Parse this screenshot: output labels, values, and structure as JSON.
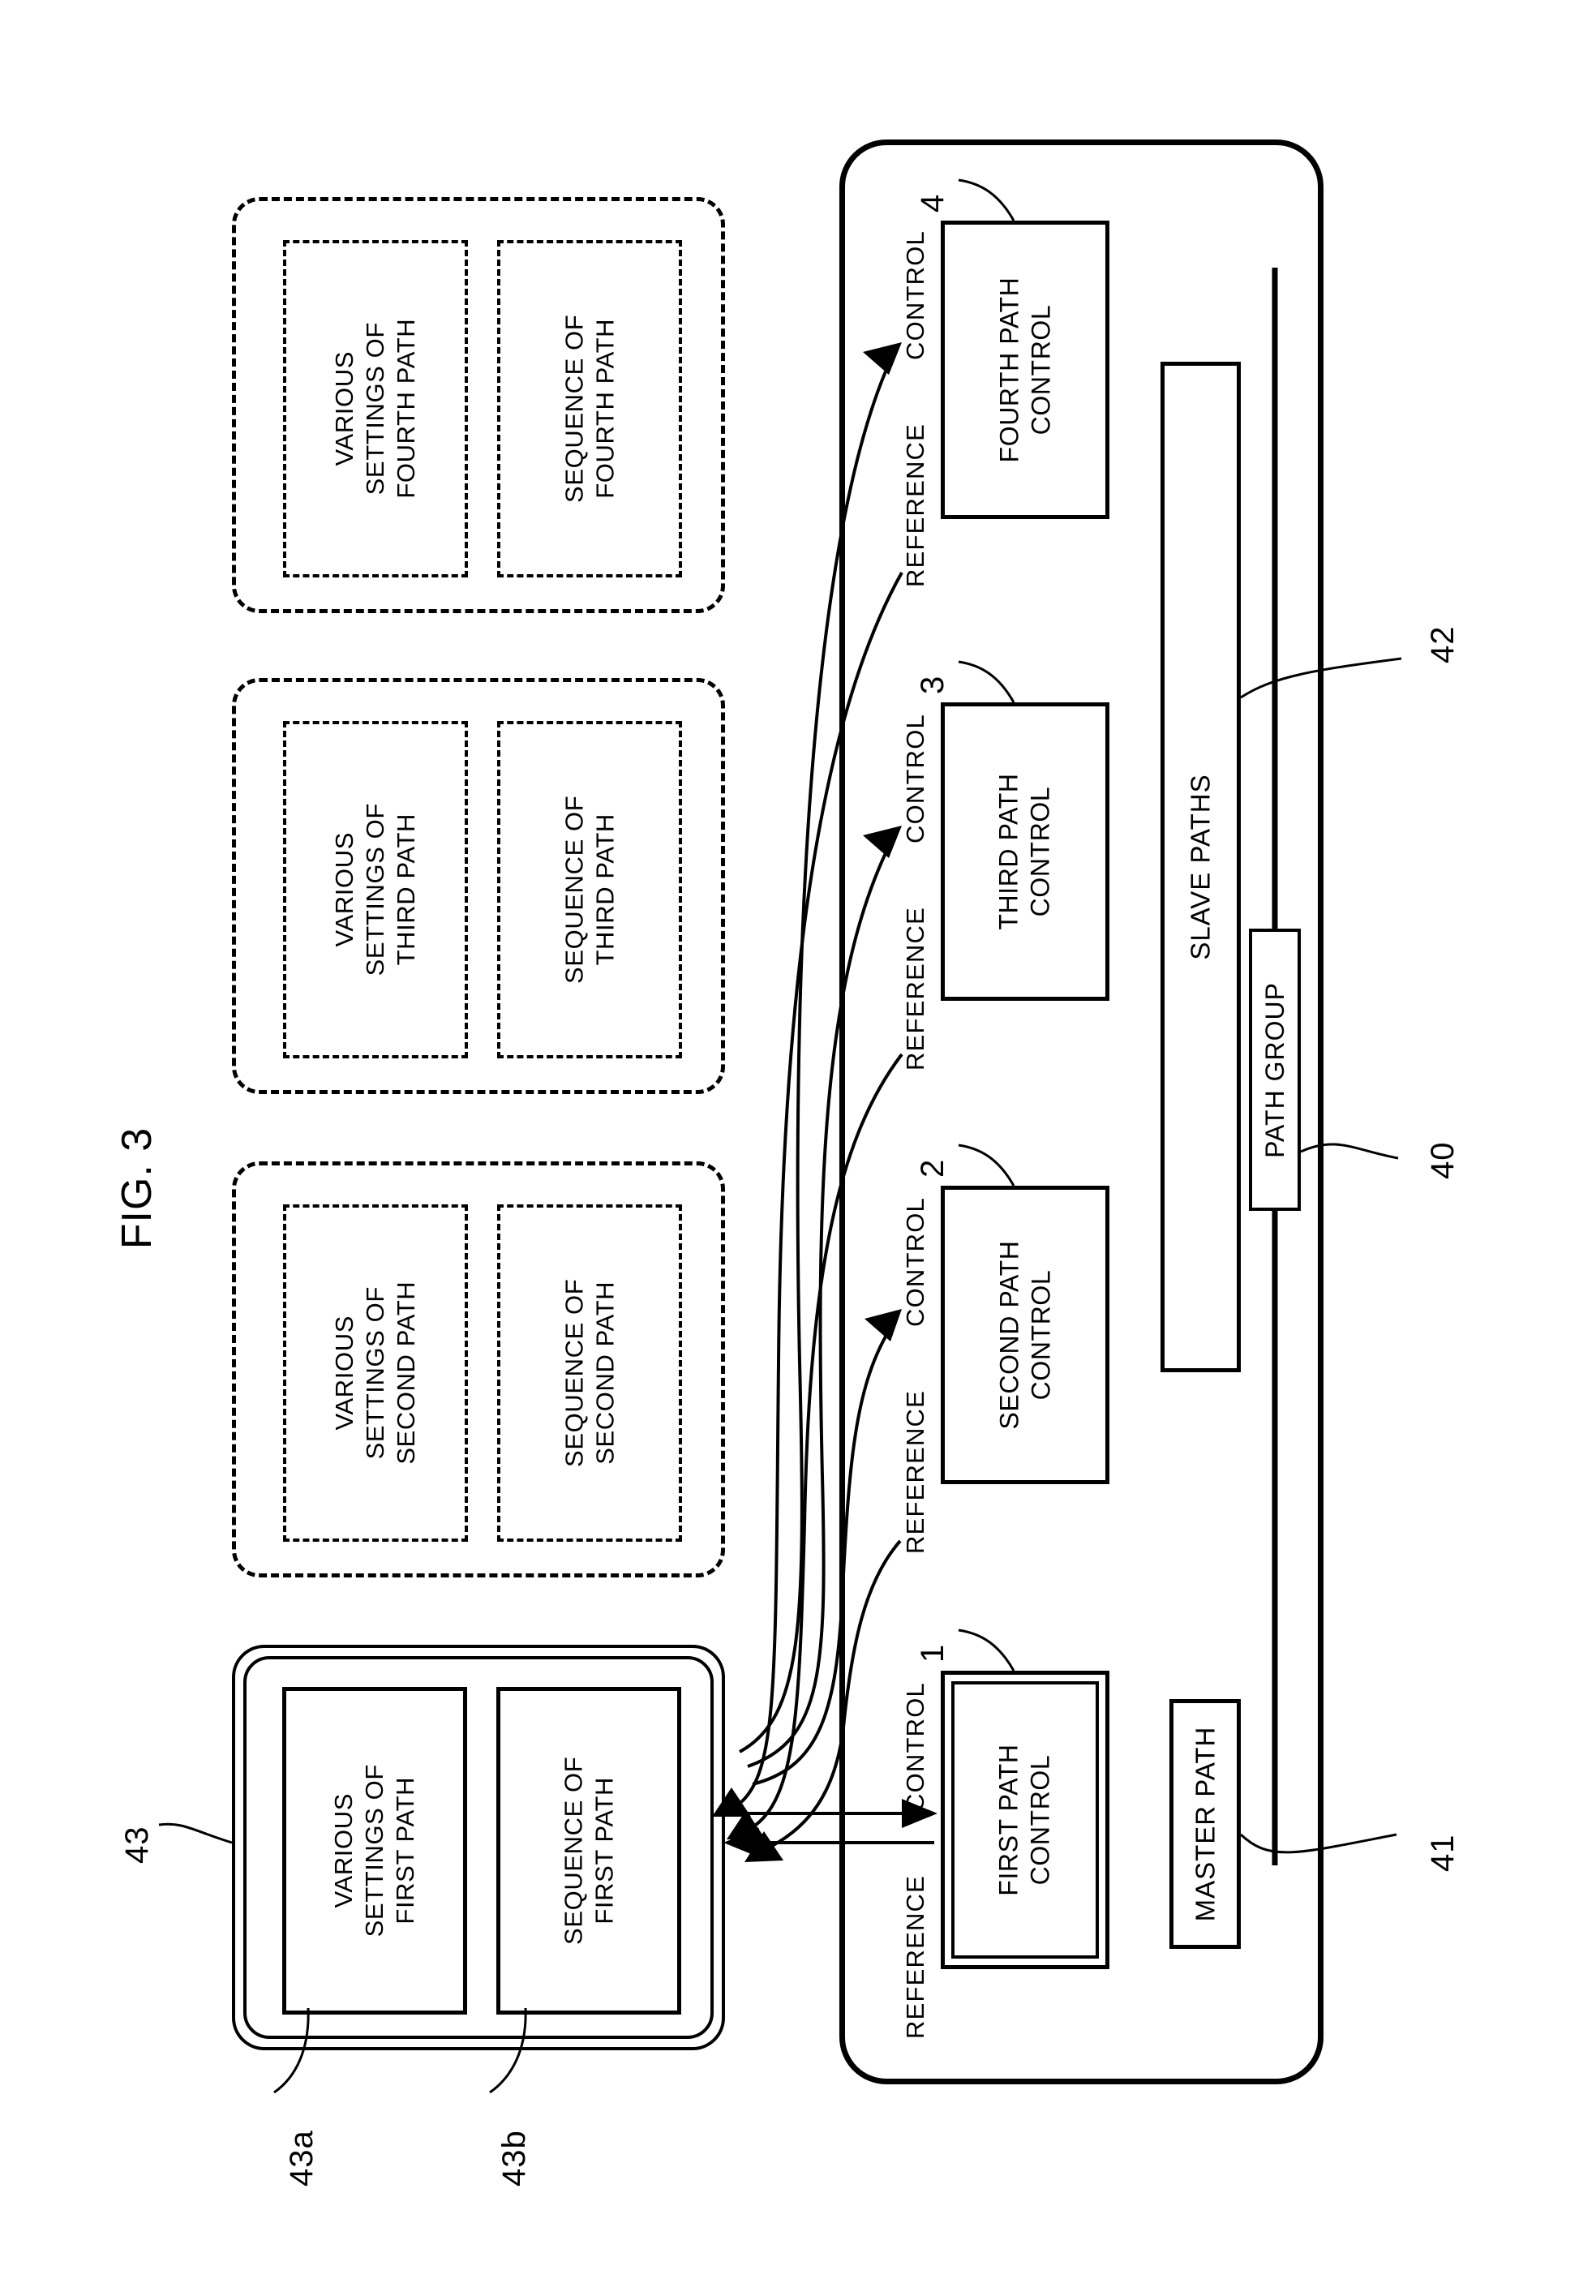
{
  "figure": {
    "label": "FIG. 3"
  },
  "settings_groups": [
    {
      "id": "fourth",
      "style": "dashed",
      "settings_label": "VARIOUS\nSETTINGS OF\nFOURTH PATH",
      "sequence_label": "SEQUENCE OF\nFOURTH PATH"
    },
    {
      "id": "third",
      "style": "dashed",
      "settings_label": "VARIOUS\nSETTINGS OF\nTHIRD PATH",
      "sequence_label": "SEQUENCE OF\nTHIRD PATH"
    },
    {
      "id": "second",
      "style": "dashed",
      "settings_label": "VARIOUS\nSETTINGS OF\nSECOND PATH",
      "sequence_label": "SEQUENCE OF\nSECOND PATH"
    },
    {
      "id": "first",
      "style": "solid-double",
      "settings_label": "VARIOUS\nSETTINGS OF\nFIRST PATH",
      "sequence_label": "SEQUENCE OF\nFIRST PATH"
    }
  ],
  "path_controls": [
    {
      "id": "fourth",
      "label": "FOURTH PATH\nCONTROL",
      "numeral": "4",
      "style": "single"
    },
    {
      "id": "third",
      "label": "THIRD PATH\nCONTROL",
      "numeral": "3",
      "style": "single"
    },
    {
      "id": "second",
      "label": "SECOND PATH\nCONTROL",
      "numeral": "2",
      "style": "single"
    },
    {
      "id": "first",
      "label": "FIRST PATH\nCONTROL",
      "numeral": "1",
      "style": "double"
    }
  ],
  "flow_captions": {
    "control": "CONTROL",
    "reference": "REFERENCE"
  },
  "path_bars": {
    "slave_paths": "SLAVE PATHS",
    "master_path": "MASTER PATH",
    "path_group": "PATH GROUP"
  },
  "reference_numerals": {
    "path_group": "40",
    "master_path": "41",
    "slave_paths": "42",
    "first_path_settings_group": "43",
    "first_path_various_settings": "43a",
    "first_path_sequence": "43b"
  },
  "colors": {
    "ink": "#000000",
    "paper": "#ffffff"
  }
}
